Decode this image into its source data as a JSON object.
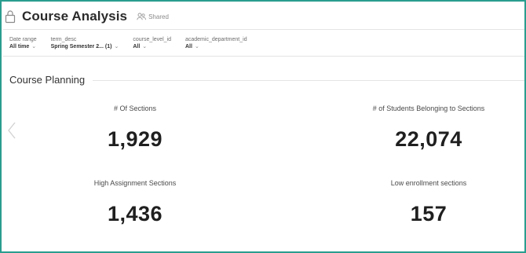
{
  "header": {
    "title": "Course Analysis",
    "shared_label": "Shared"
  },
  "filters": [
    {
      "label": "Date range",
      "value": "All time"
    },
    {
      "label": "term_desc",
      "value": "Spring Semester 2... (1)"
    },
    {
      "label": "course_level_id",
      "value": "All"
    },
    {
      "label": "academic_department_id",
      "value": "All"
    }
  ],
  "section": {
    "heading": "Course Planning"
  },
  "kpis": [
    {
      "label": "# Of Sections",
      "value": "1,929"
    },
    {
      "label": "# of Students Belonging to Sections",
      "value": "22,074"
    },
    {
      "label": "High Assignment Sections",
      "value": "1,436"
    },
    {
      "label": "Low enrollment sections",
      "value": "157"
    }
  ],
  "icons": {
    "lock": "lock-icon",
    "shared": "people-icon",
    "chevron": "chevron-down-icon",
    "nav": "chevron-left-icon"
  },
  "colors": {
    "frame_border": "#2a9d8f",
    "title_text": "#2b2b2b"
  }
}
